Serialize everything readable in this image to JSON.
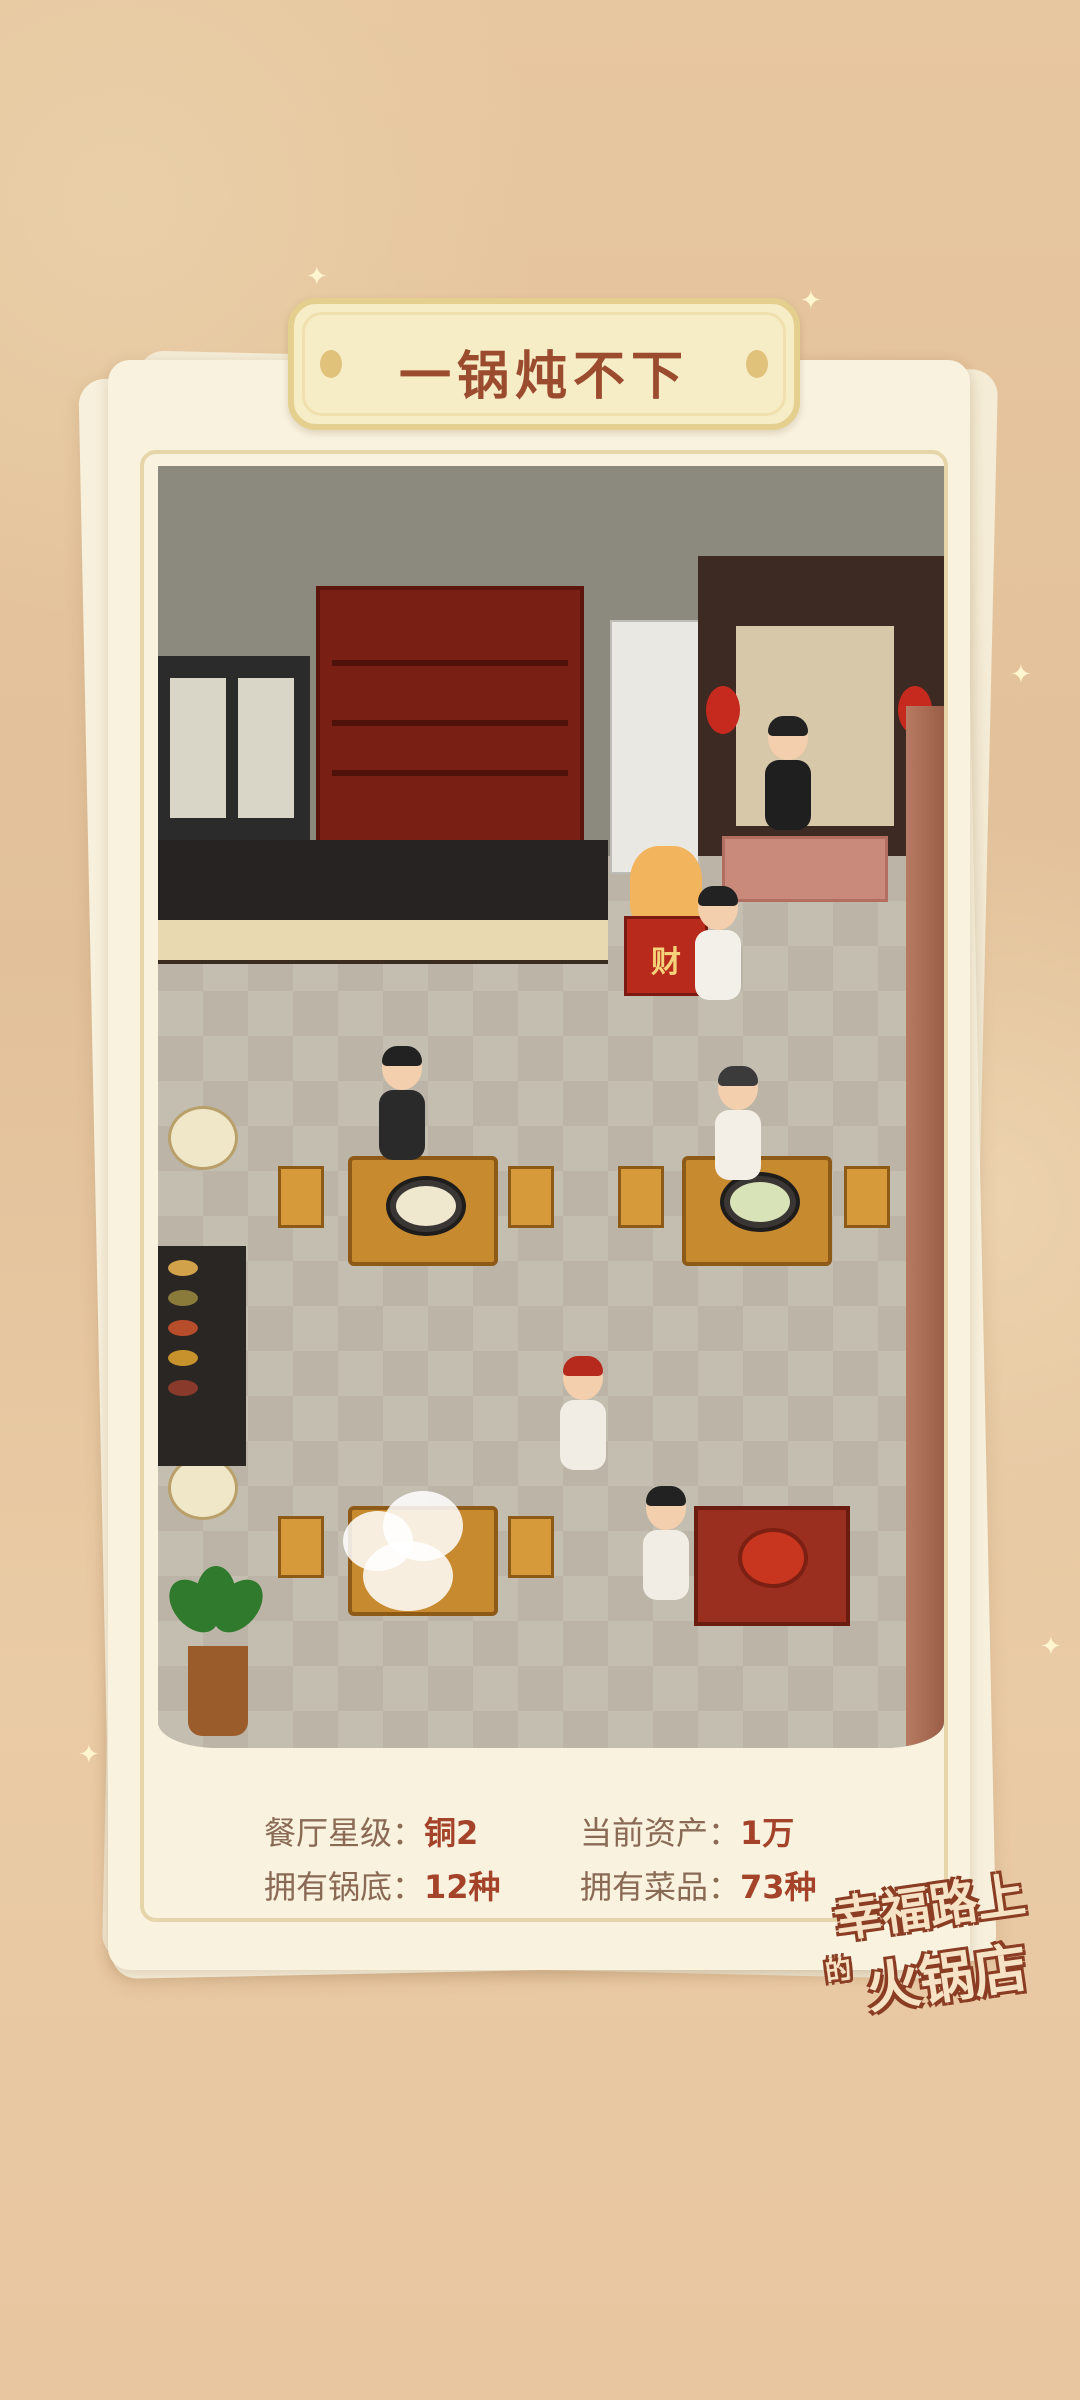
{
  "banner": {
    "title": "一锅炖不下"
  },
  "stats": {
    "rating_label": "餐厅星级：",
    "rating_value": "铜2",
    "assets_label": "当前资产：",
    "assets_value": "1万",
    "bases_label": "拥有锅底：",
    "bases_value": "12种",
    "dishes_label": "拥有菜品：",
    "dishes_value": "73种"
  },
  "logo": {
    "line1": "幸福路上",
    "line2": "火锅店",
    "small": "的"
  },
  "scene": {
    "cat_box_label": "财"
  },
  "colors": {
    "background": "#e6c9a2",
    "card": "#f8f2df",
    "banner_text": "#9b4b2e",
    "stat_value": "#a4422a"
  }
}
